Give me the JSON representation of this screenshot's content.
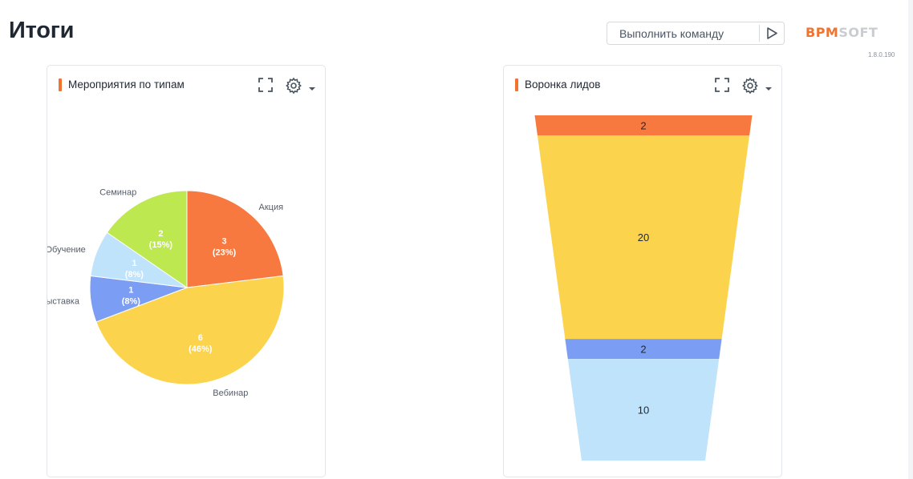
{
  "page": {
    "title": "Итоги"
  },
  "command": {
    "placeholder": "Выполнить команду"
  },
  "logo": {
    "part1": "BPM",
    "part2": "SOFT",
    "version": "1.8.0.190"
  },
  "widgets": [
    {
      "title": "Мероприятия по типам",
      "chart_data": {
        "type": "pie",
        "slices": [
          {
            "label": "Акция",
            "value": 3,
            "percent": "23%",
            "color": "#f7793f"
          },
          {
            "label": "Вебинар",
            "value": 6,
            "percent": "46%",
            "color": "#fcd34d"
          },
          {
            "label": "Выставка",
            "value": 1,
            "percent": "8%",
            "color": "#7b9ef4"
          },
          {
            "label": "Обучение",
            "value": 1,
            "percent": "8%",
            "color": "#bfe3fb"
          },
          {
            "label": "Семинар",
            "value": 2,
            "percent": "15%",
            "color": "#bde84f"
          }
        ]
      }
    },
    {
      "title": "Воронка лидов",
      "chart_data": {
        "type": "funnel",
        "stages": [
          {
            "value": 2,
            "color": "#f7793f"
          },
          {
            "value": 20,
            "color": "#fcd34d"
          },
          {
            "value": 2,
            "color": "#7b9ef4"
          },
          {
            "value": 10,
            "color": "#bfe3fb"
          }
        ]
      }
    }
  ]
}
